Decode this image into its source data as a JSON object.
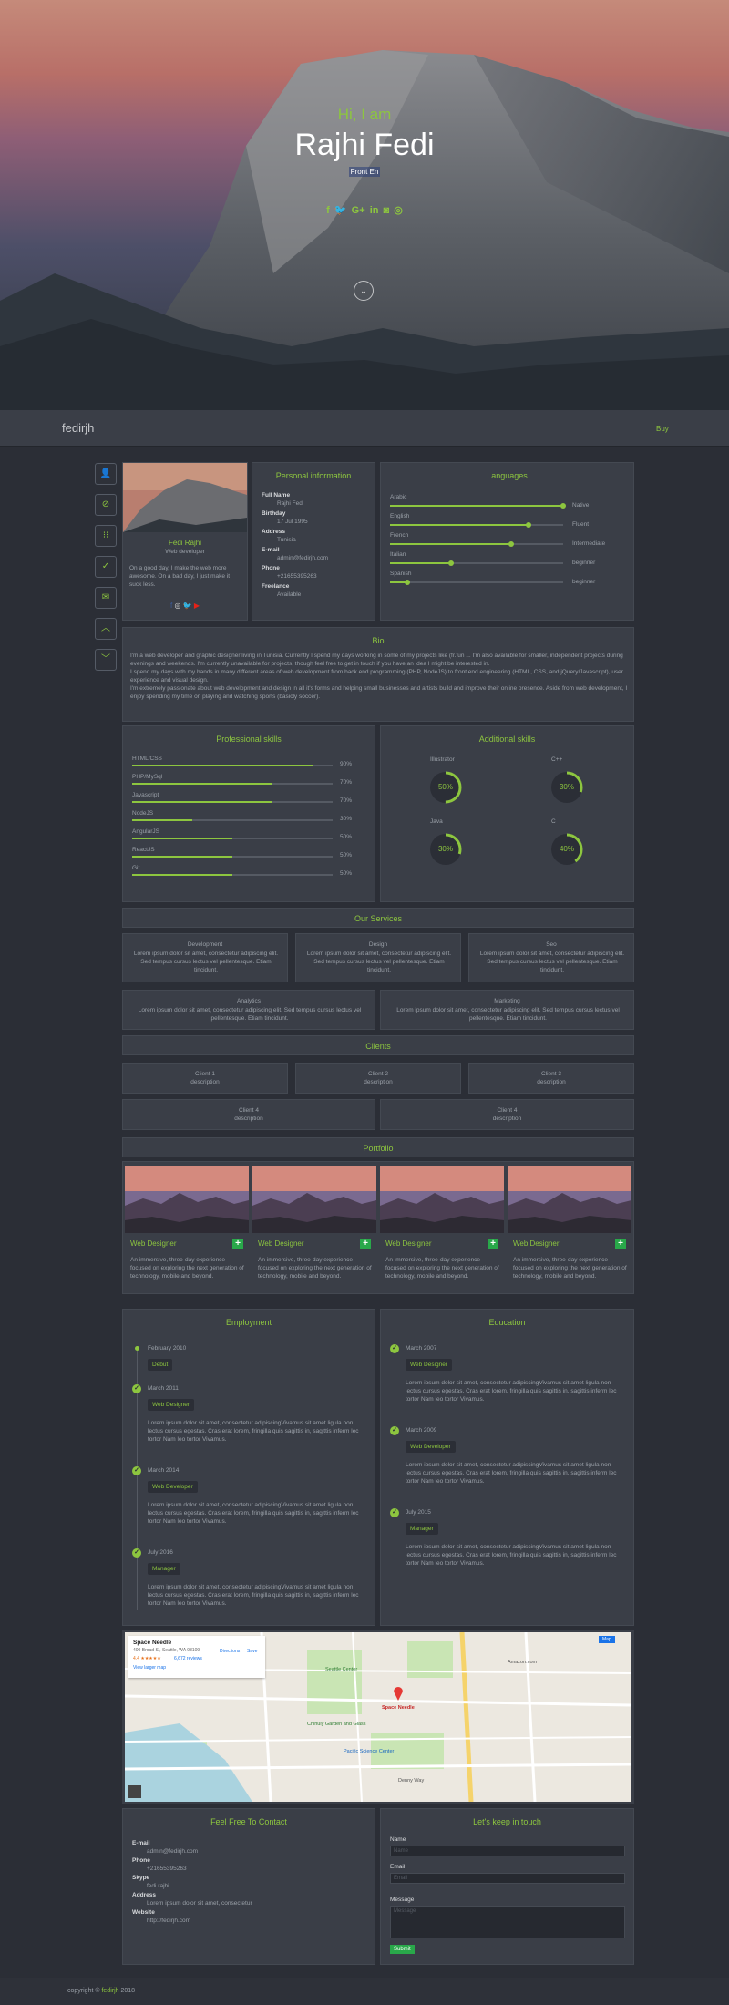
{
  "hero": {
    "greeting": "Hi, I am",
    "name": "Rajhi Fedi",
    "role": "Front En",
    "socials": [
      "f",
      "🐦",
      "G+",
      "in",
      "◙",
      "◎"
    ],
    "scroll_icon": "chevron-down-icon"
  },
  "nav": {
    "logo": "fedirjh",
    "buy": "Buy"
  },
  "sidebar_icons": [
    "user-icon",
    "paperclip-icon",
    "grid-icon",
    "check-icon",
    "mail-icon",
    "chevron-up-icon",
    "chevron-down-icon"
  ],
  "profile": {
    "name": "Fedi Rajhi",
    "title": "Web developer",
    "quote": "On a good day, I make the web more awesome. On a bad day, I just make it suck less.",
    "socials": [
      "f",
      "◎",
      "🐦",
      "▶"
    ]
  },
  "personal": {
    "title": "Personal information",
    "fields": [
      {
        "label": "Full Name",
        "value": "Rajhi Fedi"
      },
      {
        "label": "Birthday",
        "value": "17 Jul 1995"
      },
      {
        "label": "Address",
        "value": "Tunisia"
      },
      {
        "label": "E-mail",
        "value": "admin@fedirjh.com"
      },
      {
        "label": "Phone",
        "value": "+21655395263"
      },
      {
        "label": "Freelance",
        "value": "Available"
      }
    ]
  },
  "languages": {
    "title": "Languages",
    "items": [
      {
        "name": "Arabic",
        "level": "Native",
        "pct": 1.0
      },
      {
        "name": "English",
        "level": "Fluent",
        "pct": 0.8
      },
      {
        "name": "French",
        "level": "Intermediate",
        "pct": 0.7
      },
      {
        "name": "Italian",
        "level": "beginner",
        "pct": 0.35
      },
      {
        "name": "Spanish",
        "level": "beginner",
        "pct": 0.1
      }
    ]
  },
  "bio": {
    "title": "Bio",
    "text": [
      "I'm a web developer and graphic designer living in Tunisia. Currently I spend my days working in some of my projects like (fr.fun ... I'm also available for smaller, independent projects during evenings and weekends. I'm currently unavailable for projects, though feel free to get in touch if you have an idea I might be interested in.",
      "I spend my days with my hands in many different areas of web development from back end programming (PHP, NodeJS) to front end engineering (HTML, CSS, and jQuery/Javascript), user experience and visual design.",
      "I'm extremely passionate about web development and design in all it's forms and helping small businesses and artists build and improve their online presence. Aside from web development, I enjoy spending my time on playing and watching sports (basicly soccer)."
    ]
  },
  "skills": {
    "title": "Professional skills",
    "items": [
      {
        "name": "HTML/CSS",
        "pct": "90%",
        "v": 0.9
      },
      {
        "name": "PHP/MySql",
        "pct": "70%",
        "v": 0.7
      },
      {
        "name": "Javascript",
        "pct": "70%",
        "v": 0.7
      },
      {
        "name": "NodeJS",
        "pct": "30%",
        "v": 0.3
      },
      {
        "name": "AngularJS",
        "pct": "50%",
        "v": 0.5
      },
      {
        "name": "ReactJS",
        "pct": "50%",
        "v": 0.5
      },
      {
        "name": "Git",
        "pct": "50%",
        "v": 0.5
      }
    ]
  },
  "additional": {
    "title": "Additional skills",
    "items": [
      {
        "name": "Illustrator",
        "pct": "50%",
        "v": 0.5
      },
      {
        "name": "C++",
        "pct": "30%",
        "v": 0.3
      },
      {
        "name": "Java",
        "pct": "30%",
        "v": 0.3
      },
      {
        "name": "C",
        "pct": "40%",
        "v": 0.4
      }
    ]
  },
  "services": {
    "title": "Our Services",
    "items": [
      {
        "name": "Development",
        "desc": "Lorem ipsum dolor sit amet, consectetur adipiscing elit. Sed tempus cursus lectus vel pellentesque. Etiam tincidunt."
      },
      {
        "name": "Design",
        "desc": "Lorem ipsum dolor sit amet, consectetur adipiscing elit. Sed tempus cursus lectus vel pellentesque. Etiam tincidunt."
      },
      {
        "name": "Seo",
        "desc": "Lorem ipsum dolor sit amet, consectetur adipiscing elit. Sed tempus cursus lectus vel pellentesque. Etiam tincidunt."
      },
      {
        "name": "Analytics",
        "desc": "Lorem ipsum dolor sit amet, consectetur adipiscing elit. Sed tempus cursus lectus vel pellentesque. Etiam tincidunt."
      },
      {
        "name": "Marketing",
        "desc": "Lorem ipsum dolor sit amet, consectetur adipiscing elit. Sed tempus cursus lectus vel pellentesque. Etiam tincidunt."
      }
    ]
  },
  "clients": {
    "title": "Clients",
    "items": [
      {
        "name": "Client 1",
        "desc": "description"
      },
      {
        "name": "Client 2",
        "desc": "description"
      },
      {
        "name": "Client 3",
        "desc": "description"
      },
      {
        "name": "Client 4",
        "desc": "description"
      },
      {
        "name": "Client 4",
        "desc": "description"
      }
    ]
  },
  "portfolio": {
    "title": "Portfolio",
    "items": [
      {
        "name": "Web Designer",
        "desc": "An immersive, three-day experience focused on exploring the next generation of technology, mobile and beyond."
      },
      {
        "name": "Web Designer",
        "desc": "An immersive, three-day experience focused on exploring the next generation of technology, mobile and beyond."
      },
      {
        "name": "Web Designer",
        "desc": "An immersive, three-day experience focused on exploring the next generation of technology, mobile and beyond."
      },
      {
        "name": "Web Designer",
        "desc": "An immersive, three-day experience focused on exploring the next generation of technology, mobile and beyond."
      }
    ]
  },
  "employment": {
    "title": "Employment",
    "items": [
      {
        "date": "February 2010",
        "tag": "Debut",
        "text": ""
      },
      {
        "date": "March 2011",
        "tag": "Web Designer",
        "text": "Lorem ipsum dolor sit amet, consectetur adipiscingVivamus sit amet ligula non lectus cursus egestas. Cras erat lorem, fringilla quis sagittis in, sagittis inferm lec tortor Nam leo tortor Vivamus."
      },
      {
        "date": "March 2014",
        "tag": "Web Developer",
        "text": "Lorem ipsum dolor sit amet, consectetur adipiscingVivamus sit amet ligula non lectus cursus egestas. Cras erat lorem, fringilla quis sagittis in, sagittis inferm lec tortor Nam leo tortor Vivamus."
      },
      {
        "date": "July 2016",
        "tag": "Manager",
        "text": "Lorem ipsum dolor sit amet, consectetur adipiscingVivamus sit amet ligula non lectus cursus egestas. Cras erat lorem, fringilla quis sagittis in, sagittis inferm lec tortor Nam leo tortor Vivamus."
      }
    ]
  },
  "education": {
    "title": "Education",
    "items": [
      {
        "date": "March 2007",
        "tag": "Web Designer",
        "text": "Lorem ipsum dolor sit amet, consectetur adipiscingVivamus sit amet ligula non lectus cursus egestas. Cras erat lorem, fringilla quis sagittis in, sagittis inferm lec tortor Nam leo tortor Vivamus."
      },
      {
        "date": "March 2009",
        "tag": "Web Developer",
        "text": "Lorem ipsum dolor sit amet, consectetur adipiscingVivamus sit amet ligula non lectus cursus egestas. Cras erat lorem, fringilla quis sagittis in, sagittis inferm lec tortor Nam leo tortor Vivamus."
      },
      {
        "date": "July 2015",
        "tag": "Manager",
        "text": "Lorem ipsum dolor sit amet, consectetur adipiscingVivamus sit amet ligula non lectus cursus egestas. Cras erat lorem, fringilla quis sagittis in, sagittis inferm lec tortor Nam leo tortor Vivamus."
      }
    ]
  },
  "map": {
    "place": "Space Needle",
    "address": "400 Broad St, Seattle, WA 98109",
    "rating": "4.4 ★★★★★",
    "reviews": "6,672 reviews",
    "larger": "View larger map",
    "directions": "Directions",
    "save": "Save",
    "labels": [
      "Seattle Center",
      "Space Needle",
      "Chihuly Garden and Glass",
      "Pacific Science Center",
      "Denny Way",
      "Amazon.com"
    ],
    "mode": "Map"
  },
  "contact": {
    "title": "Feel Free To Contact",
    "fields": [
      {
        "label": "E-mail",
        "value": "admin@fedirjh.com"
      },
      {
        "label": "Phone",
        "value": "+21655395263"
      },
      {
        "label": "Skype",
        "value": "fedi.rajhi"
      },
      {
        "label": "Address",
        "value": "Lorem ipsum dolor sit amet, consectetur"
      },
      {
        "label": "Website",
        "value": "http://fedirjh.com"
      }
    ]
  },
  "form": {
    "title": "Let's keep in touch",
    "name_label": "Name",
    "name_ph": "Name",
    "email_label": "Email",
    "email_ph": "Email",
    "message_label": "Message",
    "message_ph": "Message",
    "submit": "Submit"
  },
  "footer": {
    "copyright": "copyright ©",
    "author": "fedirjh",
    "year": "2018"
  },
  "colors": {
    "accent": "#8dc63f",
    "bg": "#2b2e36",
    "panel": "#3a3e47"
  }
}
